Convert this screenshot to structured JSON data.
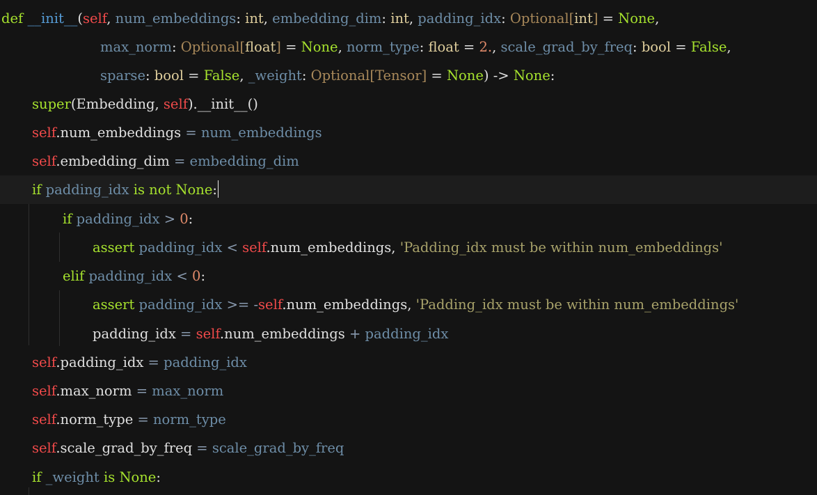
{
  "editor": {
    "language": "python",
    "theme_colors": {
      "background": "#141414",
      "current_line": "#1d1d1d",
      "keyword": "#a6e22e",
      "function_name": "#569cd6",
      "self": "#f04a4a",
      "parameter": "#6e8ea8",
      "type_builtin": "#e0cf9d",
      "type_annotation": "#a9895a",
      "none_constant": "#a6e22e",
      "number": "#e08a6a",
      "string": "#a8a26a",
      "plain": "#e0e0e0",
      "operator": "#8a9bb0"
    },
    "lines": [
      {
        "tokens": [
          {
            "t": "def",
            "c": "keyword"
          },
          {
            "t": " ",
            "c": "plain"
          },
          {
            "t": "__init__",
            "c": "function_name"
          },
          {
            "t": "(",
            "c": "plain"
          },
          {
            "t": "self",
            "c": "self"
          },
          {
            "t": ", ",
            "c": "plain"
          },
          {
            "t": "num_embeddings",
            "c": "parameter"
          },
          {
            "t": ": ",
            "c": "plain"
          },
          {
            "t": "int",
            "c": "type_builtin"
          },
          {
            "t": ", ",
            "c": "plain"
          },
          {
            "t": "embedding_dim",
            "c": "parameter"
          },
          {
            "t": ": ",
            "c": "plain"
          },
          {
            "t": "int",
            "c": "type_builtin"
          },
          {
            "t": ", ",
            "c": "plain"
          },
          {
            "t": "padding_idx",
            "c": "parameter"
          },
          {
            "t": ": ",
            "c": "plain"
          },
          {
            "t": "Optional",
            "c": "type_annotation"
          },
          {
            "t": "[",
            "c": "type_annotation"
          },
          {
            "t": "int",
            "c": "type_builtin"
          },
          {
            "t": "]",
            "c": "type_annotation"
          },
          {
            "t": " = ",
            "c": "plain"
          },
          {
            "t": "None",
            "c": "none_constant"
          },
          {
            "t": ",",
            "c": "plain"
          }
        ]
      },
      {
        "tokens": [
          {
            "t": "max_norm",
            "c": "parameter"
          },
          {
            "t": ": ",
            "c": "plain"
          },
          {
            "t": "Optional",
            "c": "type_annotation"
          },
          {
            "t": "[",
            "c": "type_annotation"
          },
          {
            "t": "float",
            "c": "type_builtin"
          },
          {
            "t": "]",
            "c": "type_annotation"
          },
          {
            "t": " = ",
            "c": "plain"
          },
          {
            "t": "None",
            "c": "none_constant"
          },
          {
            "t": ", ",
            "c": "plain"
          },
          {
            "t": "norm_type",
            "c": "parameter"
          },
          {
            "t": ": ",
            "c": "plain"
          },
          {
            "t": "float",
            "c": "type_builtin"
          },
          {
            "t": " = ",
            "c": "plain"
          },
          {
            "t": "2.",
            "c": "number"
          },
          {
            "t": ", ",
            "c": "plain"
          },
          {
            "t": "scale_grad_by_freq",
            "c": "parameter"
          },
          {
            "t": ": ",
            "c": "plain"
          },
          {
            "t": "bool",
            "c": "type_builtin"
          },
          {
            "t": " = ",
            "c": "plain"
          },
          {
            "t": "False",
            "c": "none_constant"
          },
          {
            "t": ",",
            "c": "plain"
          }
        ]
      },
      {
        "tokens": [
          {
            "t": "sparse",
            "c": "parameter"
          },
          {
            "t": ": ",
            "c": "plain"
          },
          {
            "t": "bool",
            "c": "type_builtin"
          },
          {
            "t": " = ",
            "c": "plain"
          },
          {
            "t": "False",
            "c": "none_constant"
          },
          {
            "t": ", ",
            "c": "plain"
          },
          {
            "t": "_weight",
            "c": "parameter"
          },
          {
            "t": ": ",
            "c": "plain"
          },
          {
            "t": "Optional",
            "c": "type_annotation"
          },
          {
            "t": "[Tensor]",
            "c": "type_annotation"
          },
          {
            "t": " = ",
            "c": "plain"
          },
          {
            "t": "None",
            "c": "none_constant"
          },
          {
            "t": ") -> ",
            "c": "plain"
          },
          {
            "t": "None",
            "c": "none_constant"
          },
          {
            "t": ":",
            "c": "plain"
          }
        ]
      },
      {
        "tokens": [
          {
            "t": "super",
            "c": "keyword"
          },
          {
            "t": "(Embedding, ",
            "c": "plain"
          },
          {
            "t": "self",
            "c": "self"
          },
          {
            "t": ").__init__()",
            "c": "plain"
          }
        ]
      },
      {
        "tokens": [
          {
            "t": "self",
            "c": "self"
          },
          {
            "t": ".num_embeddings",
            "c": "plain"
          },
          {
            "t": " = ",
            "c": "operator"
          },
          {
            "t": "num_embeddings",
            "c": "parameter"
          }
        ]
      },
      {
        "tokens": [
          {
            "t": "self",
            "c": "self"
          },
          {
            "t": ".embedding_dim",
            "c": "plain"
          },
          {
            "t": " = ",
            "c": "operator"
          },
          {
            "t": "embedding_dim",
            "c": "parameter"
          }
        ]
      },
      {
        "tokens": [
          {
            "t": "if",
            "c": "keyword"
          },
          {
            "t": " ",
            "c": "plain"
          },
          {
            "t": "padding_idx",
            "c": "parameter"
          },
          {
            "t": " ",
            "c": "plain"
          },
          {
            "t": "is not",
            "c": "keyword"
          },
          {
            "t": " ",
            "c": "plain"
          },
          {
            "t": "None",
            "c": "none_constant"
          },
          {
            "t": ":",
            "c": "plain"
          }
        ]
      },
      {
        "tokens": [
          {
            "t": "if",
            "c": "keyword"
          },
          {
            "t": " ",
            "c": "plain"
          },
          {
            "t": "padding_idx",
            "c": "parameter"
          },
          {
            "t": " > ",
            "c": "operator"
          },
          {
            "t": "0",
            "c": "number"
          },
          {
            "t": ":",
            "c": "plain"
          }
        ]
      },
      {
        "tokens": [
          {
            "t": "assert",
            "c": "keyword"
          },
          {
            "t": " ",
            "c": "plain"
          },
          {
            "t": "padding_idx",
            "c": "parameter"
          },
          {
            "t": " < ",
            "c": "operator"
          },
          {
            "t": "self",
            "c": "self"
          },
          {
            "t": ".num_embeddings, ",
            "c": "plain"
          },
          {
            "t": "'Padding_idx must be within num_embeddings'",
            "c": "string"
          }
        ]
      },
      {
        "tokens": [
          {
            "t": "elif",
            "c": "keyword"
          },
          {
            "t": " ",
            "c": "plain"
          },
          {
            "t": "padding_idx",
            "c": "parameter"
          },
          {
            "t": " < ",
            "c": "operator"
          },
          {
            "t": "0",
            "c": "number"
          },
          {
            "t": ":",
            "c": "plain"
          }
        ]
      },
      {
        "tokens": [
          {
            "t": "assert",
            "c": "keyword"
          },
          {
            "t": " ",
            "c": "plain"
          },
          {
            "t": "padding_idx",
            "c": "parameter"
          },
          {
            "t": " >= -",
            "c": "operator"
          },
          {
            "t": "self",
            "c": "self"
          },
          {
            "t": ".num_embeddings, ",
            "c": "plain"
          },
          {
            "t": "'Padding_idx must be within num_embeddings'",
            "c": "string"
          }
        ]
      },
      {
        "tokens": [
          {
            "t": "padding_idx",
            "c": "plain"
          },
          {
            "t": " = ",
            "c": "operator"
          },
          {
            "t": "self",
            "c": "self"
          },
          {
            "t": ".num_embeddings",
            "c": "plain"
          },
          {
            "t": " + ",
            "c": "operator"
          },
          {
            "t": "padding_idx",
            "c": "parameter"
          }
        ]
      },
      {
        "tokens": [
          {
            "t": "self",
            "c": "self"
          },
          {
            "t": ".padding_idx",
            "c": "plain"
          },
          {
            "t": " = ",
            "c": "operator"
          },
          {
            "t": "padding_idx",
            "c": "parameter"
          }
        ]
      },
      {
        "tokens": [
          {
            "t": "self",
            "c": "self"
          },
          {
            "t": ".max_norm",
            "c": "plain"
          },
          {
            "t": " = ",
            "c": "operator"
          },
          {
            "t": "max_norm",
            "c": "parameter"
          }
        ]
      },
      {
        "tokens": [
          {
            "t": "self",
            "c": "self"
          },
          {
            "t": ".norm_type",
            "c": "plain"
          },
          {
            "t": " = ",
            "c": "operator"
          },
          {
            "t": "norm_type",
            "c": "parameter"
          }
        ]
      },
      {
        "tokens": [
          {
            "t": "self",
            "c": "self"
          },
          {
            "t": ".scale_grad_by_freq",
            "c": "plain"
          },
          {
            "t": " = ",
            "c": "operator"
          },
          {
            "t": "scale_grad_by_freq",
            "c": "parameter"
          }
        ]
      },
      {
        "tokens": [
          {
            "t": "if",
            "c": "keyword"
          },
          {
            "t": " ",
            "c": "plain"
          },
          {
            "t": "_weight",
            "c": "parameter"
          },
          {
            "t": " ",
            "c": "plain"
          },
          {
            "t": "is",
            "c": "keyword"
          },
          {
            "t": " ",
            "c": "plain"
          },
          {
            "t": "None",
            "c": "none_constant"
          },
          {
            "t": ":",
            "c": "plain"
          }
        ]
      }
    ]
  }
}
